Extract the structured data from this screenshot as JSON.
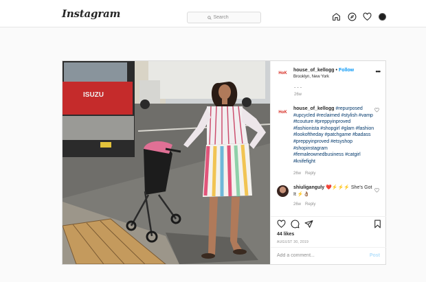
{
  "app": {
    "logo": "Instagram"
  },
  "search": {
    "placeholder": "Search"
  },
  "post": {
    "username": "house_of_kellogg",
    "follow_label": "Follow",
    "location": "Brooklyn, New York",
    "avatar_text": "HoK",
    "first_comment_age": "26w",
    "caption": {
      "username": "house_of_kellogg",
      "hashtags": "#repurposed #upcycled #reclaimed #stylish #vamp #tcouture #preppyinproved #fashionista #shopgirl #glam #fashion #lookoftheday #patchgame #badass #preppyinproved #etsyshop #shopinstagram #femaleownedbusiness #catgirl #knifefight",
      "age": "26w",
      "reply": "Reply"
    },
    "comment": {
      "username": "shiuliganguly",
      "text": "❤️⚡⚡⚡ She's Got It ⚡👌🏽",
      "age": "26w",
      "reply": "Reply"
    },
    "likes": "44 likes",
    "date": "AUGUST 30, 2019",
    "add_comment_placeholder": "Add a comment...",
    "post_label": "Post"
  },
  "colors": {
    "accent": "#0095f6",
    "brand_red": "#d6281f",
    "muted": "#8e8e8e"
  }
}
